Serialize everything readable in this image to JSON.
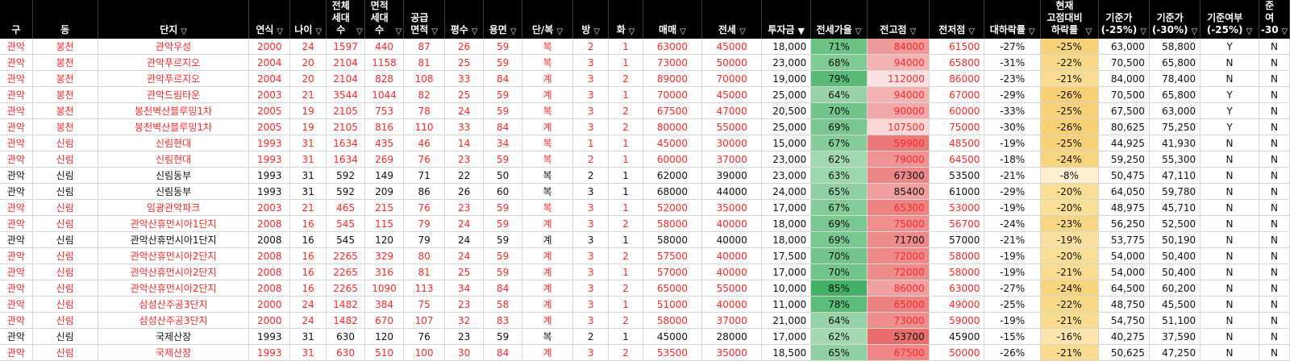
{
  "columns": [
    {
      "key": "gu",
      "label": "구",
      "filter": false,
      "w": 38
    },
    {
      "key": "dong",
      "label": "동",
      "filter": false,
      "w": 77
    },
    {
      "key": "danji",
      "label": "단지",
      "filter": true,
      "w": 178
    },
    {
      "key": "year",
      "label": "연식",
      "filter": true,
      "w": 48
    },
    {
      "key": "age",
      "label": "나이",
      "filter": true,
      "w": 43
    },
    {
      "key": "households",
      "label": "전체\n세대수",
      "filter": true,
      "w": 45
    },
    {
      "key": "area_households",
      "label": "면적\n세대수",
      "filter": true,
      "w": 46
    },
    {
      "key": "supply",
      "label": "공급\n면적",
      "filter": true,
      "w": 48
    },
    {
      "key": "pyeong",
      "label": "평수",
      "filter": true,
      "w": 46
    },
    {
      "key": "use_area",
      "label": "용면",
      "filter": true,
      "w": 45
    },
    {
      "key": "type",
      "label": "단/복",
      "filter": true,
      "w": 60
    },
    {
      "key": "rooms",
      "label": "방",
      "filter": true,
      "w": 42
    },
    {
      "key": "baths",
      "label": "화",
      "filter": true,
      "w": 40
    },
    {
      "key": "sale",
      "label": "매매",
      "filter": true,
      "w": 70
    },
    {
      "key": "jeonse",
      "label": "전세",
      "filter": true,
      "w": 70
    },
    {
      "key": "invest",
      "label": "투자금",
      "filter": true,
      "w": 58,
      "active": true
    },
    {
      "key": "ratio",
      "label": "전세가율",
      "filter": true,
      "w": 66
    },
    {
      "key": "high",
      "label": "전고점",
      "filter": true,
      "w": 73
    },
    {
      "key": "jeonjeo",
      "label": "전저점",
      "filter": true,
      "w": 65
    },
    {
      "key": "drop_high",
      "label": "대하락률",
      "filter": true,
      "w": 66
    },
    {
      "key": "drop_fixed",
      "label": "현재\n고점대비\n하락률",
      "filter": true,
      "w": 68
    },
    {
      "key": "base25",
      "label": "기준가\n(-25%)",
      "filter": true,
      "w": 60
    },
    {
      "key": "base30",
      "label": "기준가\n(-30%)",
      "filter": true,
      "w": 60
    },
    {
      "key": "ok25",
      "label": "기준여부\n(-25%)",
      "filter": true,
      "w": 69
    },
    {
      "key": "ok30",
      "label": "준여\n-30%",
      "filter": true,
      "w": 36
    }
  ],
  "rows": [
    {
      "style": "red",
      "gu": "관악",
      "dong": "봉천",
      "danji": "관악우성",
      "year": "2000",
      "age": "24",
      "households": "1597",
      "area_households": "440",
      "supply": "87",
      "pyeong": "26",
      "use_area": "59",
      "type": "복",
      "rooms": "2",
      "baths": "1",
      "sale": "63000",
      "jeonse": "45000",
      "invest": "18,000",
      "ratio": "71%",
      "ratio_color": "#6cc385",
      "high": "84000",
      "high_color": "#ef9a9a",
      "jeonjeo": "61500",
      "drop_high": "-27%",
      "drop_fixed": "-25%",
      "drop_color": "#f8d27a",
      "base25": "63,000",
      "base30": "58,800",
      "ok25": "Y",
      "ok30": "N"
    },
    {
      "style": "red",
      "gu": "관악",
      "dong": "봉천",
      "danji": "관악푸르지오",
      "year": "2004",
      "age": "20",
      "households": "2104",
      "area_households": "1158",
      "supply": "81",
      "pyeong": "25",
      "use_area": "59",
      "type": "복",
      "rooms": "3",
      "baths": "1",
      "sale": "73000",
      "jeonse": "50000",
      "invest": "23,000",
      "ratio": "68%",
      "ratio_color": "#7fcb94",
      "high": "94000",
      "high_color": "#f3b3b3",
      "jeonjeo": "65800",
      "drop_high": "-31%",
      "drop_fixed": "-22%",
      "drop_color": "#f8d988",
      "base25": "70,500",
      "base30": "65,800",
      "ok25": "N",
      "ok30": "N"
    },
    {
      "style": "red",
      "gu": "관악",
      "dong": "봉천",
      "danji": "관악푸르지오",
      "year": "2004",
      "age": "20",
      "households": "2104",
      "area_households": "828",
      "supply": "108",
      "pyeong": "33",
      "use_area": "84",
      "type": "계",
      "rooms": "3",
      "baths": "2",
      "sale": "89000",
      "jeonse": "70000",
      "invest": "19,000",
      "ratio": "79%",
      "ratio_color": "#58ba76",
      "high": "112000",
      "high_color": "#fbe1e1",
      "jeonjeo": "86000",
      "drop_high": "-23%",
      "drop_fixed": "-21%",
      "drop_color": "#f9dc90",
      "base25": "84,000",
      "base30": "78,400",
      "ok25": "N",
      "ok30": "N"
    },
    {
      "style": "red",
      "gu": "관악",
      "dong": "봉천",
      "danji": "관악드림타운",
      "year": "2003",
      "age": "21",
      "households": "3544",
      "area_households": "1044",
      "supply": "82",
      "pyeong": "25",
      "use_area": "59",
      "type": "계",
      "rooms": "3",
      "baths": "1",
      "sale": "70000",
      "jeonse": "45000",
      "invest": "25,000",
      "ratio": "64%",
      "ratio_color": "#96d4a7",
      "high": "94000",
      "high_color": "#f3b3b3",
      "jeonjeo": "67000",
      "drop_high": "-29%",
      "drop_fixed": "-26%",
      "drop_color": "#f8cf72",
      "base25": "70,500",
      "base30": "65,800",
      "ok25": "Y",
      "ok30": "N"
    },
    {
      "style": "red",
      "gu": "관악",
      "dong": "봉천",
      "danji": "봉천벽산블루밍1차",
      "year": "2005",
      "age": "19",
      "households": "2105",
      "area_households": "753",
      "supply": "78",
      "pyeong": "24",
      "use_area": "59",
      "type": "복",
      "rooms": "3",
      "baths": "2",
      "sale": "67500",
      "jeonse": "47000",
      "invest": "20,500",
      "ratio": "70%",
      "ratio_color": "#72c58a",
      "high": "90000",
      "high_color": "#f1a8a8",
      "jeonjeo": "60000",
      "drop_high": "-33%",
      "drop_fixed": "-25%",
      "drop_color": "#f8d27a",
      "base25": "67,500",
      "base30": "63,000",
      "ok25": "Y",
      "ok30": "N"
    },
    {
      "style": "red",
      "gu": "관악",
      "dong": "봉천",
      "danji": "봉천벽산블루밍1차",
      "year": "2005",
      "age": "19",
      "households": "2105",
      "area_households": "816",
      "supply": "110",
      "pyeong": "33",
      "use_area": "84",
      "type": "계",
      "rooms": "3",
      "baths": "2",
      "sale": "80000",
      "jeonse": "55000",
      "invest": "25,000",
      "ratio": "69%",
      "ratio_color": "#79c890",
      "high": "107500",
      "high_color": "#fad7d7",
      "jeonjeo": "75000",
      "drop_high": "-30%",
      "drop_fixed": "-26%",
      "drop_color": "#f8cf72",
      "base25": "80,625",
      "base30": "75,250",
      "ok25": "Y",
      "ok30": "N"
    },
    {
      "style": "red",
      "gu": "관악",
      "dong": "신림",
      "danji": "신림현대",
      "year": "1993",
      "age": "31",
      "households": "1634",
      "area_households": "435",
      "supply": "46",
      "pyeong": "14",
      "use_area": "34",
      "type": "복",
      "rooms": "1",
      "baths": "1",
      "sale": "45000",
      "jeonse": "30000",
      "invest": "15,000",
      "ratio": "67%",
      "ratio_color": "#84cd99",
      "high": "59900",
      "high_color": "#ea7a7a",
      "jeonjeo": "48500",
      "drop_high": "-19%",
      "drop_fixed": "-25%",
      "drop_color": "#f8d27a",
      "base25": "44,925",
      "base30": "41,930",
      "ok25": "N",
      "ok30": "N"
    },
    {
      "style": "red",
      "gu": "관악",
      "dong": "신림",
      "danji": "신림현대",
      "year": "1993",
      "age": "31",
      "households": "1634",
      "area_households": "269",
      "supply": "76",
      "pyeong": "23",
      "use_area": "59",
      "type": "복",
      "rooms": "2",
      "baths": "1",
      "sale": "60000",
      "jeonse": "37000",
      "invest": "23,000",
      "ratio": "62%",
      "ratio_color": "#a2d9b1",
      "high": "79000",
      "high_color": "#ef9494",
      "jeonjeo": "64500",
      "drop_high": "-18%",
      "drop_fixed": "-24%",
      "drop_color": "#f8d47e",
      "base25": "59,250",
      "base30": "55,300",
      "ok25": "N",
      "ok30": "N"
    },
    {
      "style": "blk",
      "gu": "관악",
      "dong": "신림",
      "danji": "신림동부",
      "year": "1993",
      "age": "31",
      "households": "592",
      "area_households": "149",
      "supply": "71",
      "pyeong": "22",
      "use_area": "50",
      "type": "복",
      "rooms": "2",
      "baths": "1",
      "sale": "62000",
      "jeonse": "39000",
      "invest": "23,000",
      "ratio": "63%",
      "ratio_color": "#9cd7ac",
      "high": "67300",
      "high_color": "#ed8787",
      "jeonjeo": "53500",
      "drop_high": "-21%",
      "drop_fixed": "-8%",
      "drop_color": "#fdf0d0",
      "base25": "50,475",
      "base30": "47,110",
      "ok25": "N",
      "ok30": "N"
    },
    {
      "style": "blk",
      "gu": "관악",
      "dong": "신림",
      "danji": "신림동부",
      "year": "1993",
      "age": "31",
      "households": "592",
      "area_households": "209",
      "supply": "86",
      "pyeong": "26",
      "use_area": "60",
      "type": "복",
      "rooms": "3",
      "baths": "1",
      "sale": "68000",
      "jeonse": "44000",
      "invest": "24,000",
      "ratio": "65%",
      "ratio_color": "#8fd1a2",
      "high": "85400",
      "high_color": "#f09e9e",
      "jeonjeo": "61000",
      "drop_high": "-29%",
      "drop_fixed": "-20%",
      "drop_color": "#f9de96",
      "base25": "64,050",
      "base30": "59,780",
      "ok25": "N",
      "ok30": "N"
    },
    {
      "style": "red",
      "gu": "관악",
      "dong": "신림",
      "danji": "임광관악파크",
      "year": "2003",
      "age": "21",
      "households": "465",
      "area_households": "215",
      "supply": "76",
      "pyeong": "23",
      "use_area": "59",
      "type": "복",
      "rooms": "3",
      "baths": "1",
      "sale": "52000",
      "jeonse": "35000",
      "invest": "17,000",
      "ratio": "67%",
      "ratio_color": "#84cd99",
      "high": "65300",
      "high_color": "#ec8484",
      "jeonjeo": "53000",
      "drop_high": "-19%",
      "drop_fixed": "-20%",
      "drop_color": "#f9de96",
      "base25": "48,975",
      "base30": "45,710",
      "ok25": "N",
      "ok30": "N"
    },
    {
      "style": "red",
      "gu": "관악",
      "dong": "신림",
      "danji": "관악산휴먼시아1단지",
      "year": "2008",
      "age": "16",
      "households": "545",
      "area_households": "115",
      "supply": "79",
      "pyeong": "24",
      "use_area": "59",
      "type": "계",
      "rooms": "3",
      "baths": "2",
      "sale": "58000",
      "jeonse": "40000",
      "invest": "18,000",
      "ratio": "69%",
      "ratio_color": "#79c890",
      "high": "75000",
      "high_color": "#ee8e8e",
      "jeonjeo": "56700",
      "drop_high": "-24%",
      "drop_fixed": "-23%",
      "drop_color": "#f8d784",
      "base25": "56,250",
      "base30": "52,500",
      "ok25": "N",
      "ok30": "N"
    },
    {
      "style": "blk",
      "gu": "관악",
      "dong": "신림",
      "danji": "관악산휴먼시아1단지",
      "year": "2008",
      "age": "16",
      "households": "545",
      "area_households": "120",
      "supply": "79",
      "pyeong": "24",
      "use_area": "59",
      "type": "계",
      "rooms": "3",
      "baths": "1",
      "sale": "58000",
      "jeonse": "40000",
      "invest": "18,000",
      "ratio": "69%",
      "ratio_color": "#79c890",
      "high": "71700",
      "high_color": "#ed8b8b",
      "jeonjeo": "57000",
      "drop_high": "-21%",
      "drop_fixed": "-19%",
      "drop_color": "#fae09c",
      "base25": "53,775",
      "base30": "50,190",
      "ok25": "N",
      "ok30": "N"
    },
    {
      "style": "red",
      "gu": "관악",
      "dong": "신림",
      "danji": "관악산휴먼시아2단지",
      "year": "2008",
      "age": "16",
      "households": "2265",
      "area_households": "329",
      "supply": "80",
      "pyeong": "24",
      "use_area": "59",
      "type": "계",
      "rooms": "3",
      "baths": "2",
      "sale": "57500",
      "jeonse": "40000",
      "invest": "17,500",
      "ratio": "70%",
      "ratio_color": "#72c58a",
      "high": "72000",
      "high_color": "#ed8b8b",
      "jeonjeo": "58000",
      "drop_high": "-19%",
      "drop_fixed": "-20%",
      "drop_color": "#f9de96",
      "base25": "54,000",
      "base30": "50,400",
      "ok25": "N",
      "ok30": "N"
    },
    {
      "style": "red",
      "gu": "관악",
      "dong": "신림",
      "danji": "관악산휴먼시아2단지",
      "year": "2008",
      "age": "16",
      "households": "2265",
      "area_households": "316",
      "supply": "81",
      "pyeong": "25",
      "use_area": "59",
      "type": "계",
      "rooms": "3",
      "baths": "1",
      "sale": "57000",
      "jeonse": "40000",
      "invest": "17,000",
      "ratio": "70%",
      "ratio_color": "#72c58a",
      "high": "72000",
      "high_color": "#ed8b8b",
      "jeonjeo": "58000",
      "drop_high": "-19%",
      "drop_fixed": "-21%",
      "drop_color": "#f9dc90",
      "base25": "54,000",
      "base30": "50,400",
      "ok25": "N",
      "ok30": "N"
    },
    {
      "style": "red",
      "gu": "관악",
      "dong": "신림",
      "danji": "관악산휴먼시아2단지",
      "year": "2008",
      "age": "16",
      "households": "2265",
      "area_households": "1090",
      "supply": "113",
      "pyeong": "34",
      "use_area": "84",
      "type": "계",
      "rooms": "3",
      "baths": "2",
      "sale": "65000",
      "jeonse": "55000",
      "invest": "10,000",
      "ratio": "85%",
      "ratio_color": "#43b065",
      "high": "86000",
      "high_color": "#f0a0a0",
      "jeonjeo": "63000",
      "drop_high": "-27%",
      "drop_fixed": "-24%",
      "drop_color": "#f8d47e",
      "base25": "64,500",
      "base30": "60,200",
      "ok25": "N",
      "ok30": "N"
    },
    {
      "style": "red",
      "gu": "관악",
      "dong": "신림",
      "danji": "삼성산주공3단지",
      "year": "2000",
      "age": "24",
      "households": "1482",
      "area_households": "384",
      "supply": "75",
      "pyeong": "23",
      "use_area": "58",
      "type": "계",
      "rooms": "3",
      "baths": "1",
      "sale": "51000",
      "jeonse": "40000",
      "invest": "11,000",
      "ratio": "78%",
      "ratio_color": "#5cbc79",
      "high": "65000",
      "high_color": "#ec8383",
      "jeonjeo": "49000",
      "drop_high": "-25%",
      "drop_fixed": "-22%",
      "drop_color": "#f8d988",
      "base25": "48,750",
      "base30": "45,500",
      "ok25": "N",
      "ok30": "N"
    },
    {
      "style": "red",
      "gu": "관악",
      "dong": "신림",
      "danji": "삼성산주공3단지",
      "year": "2000",
      "age": "24",
      "households": "1482",
      "area_households": "670",
      "supply": "107",
      "pyeong": "32",
      "use_area": "83",
      "type": "계",
      "rooms": "3",
      "baths": "2",
      "sale": "58000",
      "jeonse": "37000",
      "invest": "21,000",
      "ratio": "64%",
      "ratio_color": "#96d4a7",
      "high": "73000",
      "high_color": "#ee8d8d",
      "jeonjeo": "59000",
      "drop_high": "-19%",
      "drop_fixed": "-21%",
      "drop_color": "#f9dc90",
      "base25": "54,750",
      "base30": "51,100",
      "ok25": "N",
      "ok30": "N"
    },
    {
      "style": "blk",
      "gu": "관악",
      "dong": "신림",
      "danji": "국제산장",
      "year": "1993",
      "age": "31",
      "households": "630",
      "area_households": "120",
      "supply": "76",
      "pyeong": "23",
      "use_area": "59",
      "type": "복",
      "rooms": "2",
      "baths": "1",
      "sale": "45000",
      "jeonse": "28000",
      "invest": "17,000",
      "ratio": "62%",
      "ratio_color": "#a2d9b1",
      "high": "53700",
      "high_color": "#e96d6d",
      "jeonjeo": "45900",
      "drop_high": "-15%",
      "drop_fixed": "-16%",
      "drop_color": "#fbe5ac",
      "base25": "40,275",
      "base30": "37,590",
      "ok25": "N",
      "ok30": "N"
    },
    {
      "style": "red",
      "gu": "관악",
      "dong": "신림",
      "danji": "국제산장",
      "year": "1993",
      "age": "31",
      "households": "630",
      "area_households": "510",
      "supply": "100",
      "pyeong": "30",
      "use_area": "84",
      "type": "계",
      "rooms": "3",
      "baths": "2",
      "sale": "53500",
      "jeonse": "35000",
      "invest": "18,500",
      "ratio": "65%",
      "ratio_color": "#8fd1a2",
      "high": "67500",
      "high_color": "#ed8787",
      "jeonjeo": "50000",
      "drop_high": "-26%",
      "drop_fixed": "-21%",
      "drop_color": "#f9dc90",
      "base25": "50,625",
      "base30": "47,250",
      "ok25": "N",
      "ok30": "N"
    }
  ]
}
